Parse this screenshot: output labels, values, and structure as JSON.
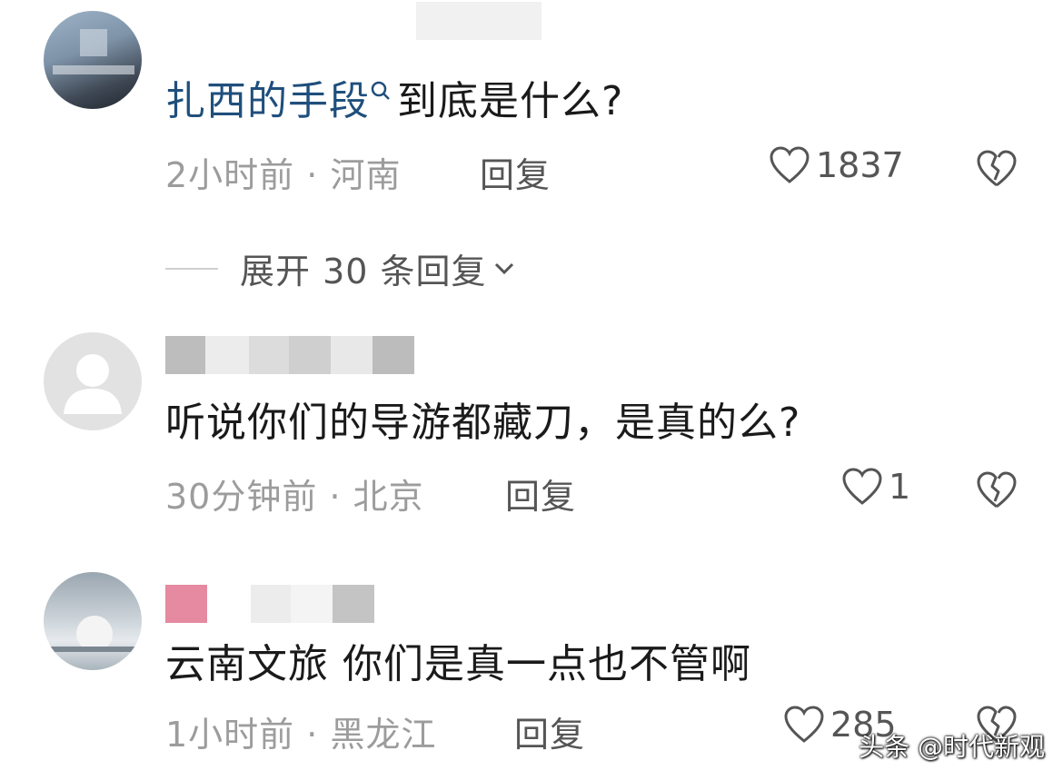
{
  "comments": [
    {
      "text_link": "扎西的手段",
      "text_rest": "到底是什么?",
      "time": "2小时前",
      "location": "河南",
      "reply_label": "回复",
      "likes": "1837"
    },
    {
      "text": "听说你们的导游都藏刀，是真的么?",
      "time": "30分钟前",
      "location": "北京",
      "reply_label": "回复",
      "likes": "1"
    },
    {
      "text": "云南文旅 你们是真一点也不管啊",
      "time": "1小时前",
      "location": "黑龙江",
      "reply_label": "回复",
      "likes": "285"
    }
  ],
  "expand_replies": "展开 30 条回复",
  "meta_separator": " · ",
  "watermark": "头条 @时代新观",
  "colors": {
    "link": "#1f4f7c",
    "meta": "#9c9c9c",
    "action": "#555555"
  }
}
